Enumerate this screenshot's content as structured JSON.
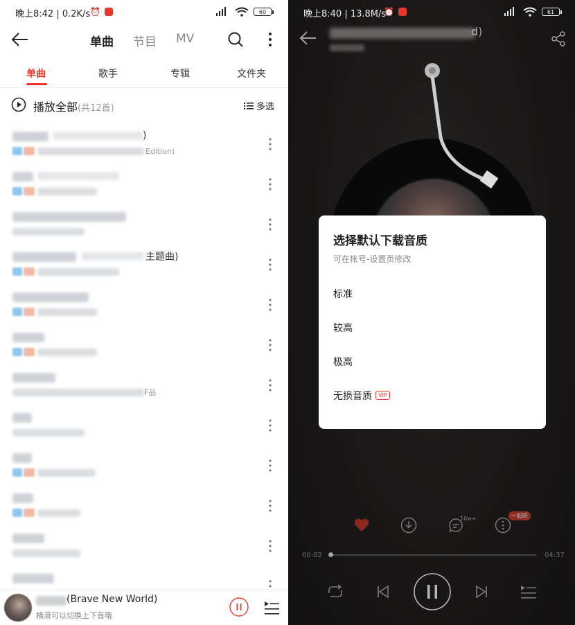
{
  "left": {
    "status_bar": {
      "text": "晚上8:42 | 0.2K/s",
      "battery": "60"
    },
    "top_nav": {
      "tabs": [
        "单曲",
        "节目",
        "MV"
      ],
      "active": "单曲"
    },
    "sub_tabs": [
      "单曲",
      "歌手",
      "专辑",
      "文件夹"
    ],
    "play_all": {
      "label": "播放全部",
      "count": "(共12首)",
      "multi_select": "多选"
    },
    "songs": [
      {
        "title_fragment": ")",
        "sub_fragment": "Edition)"
      },
      {
        "title_fragment": "",
        "sub_fragment": ""
      },
      {
        "title_fragment": "",
        "sub_fragment": ""
      },
      {
        "title_fragment": "主题曲)",
        "sub_fragment": ""
      },
      {
        "title_fragment": "",
        "sub_fragment": ""
      },
      {
        "title_fragment": "",
        "sub_fragment": ""
      },
      {
        "title_fragment": "",
        "sub_fragment": "F品"
      },
      {
        "title_fragment": "",
        "sub_fragment": ""
      },
      {
        "title_fragment": "",
        "sub_fragment": ""
      },
      {
        "title_fragment": "",
        "sub_fragment": ""
      },
      {
        "title_fragment": "",
        "sub_fragment": ""
      },
      {
        "title_fragment": "",
        "sub_fragment": ""
      }
    ],
    "mini_player": {
      "title": "(Brave New World)",
      "hint": "横滑可以切换上下首哦"
    }
  },
  "right": {
    "status_bar": {
      "text": "晚上8:40 | 13.8M/s",
      "battery": "61"
    },
    "title_fragment": "d)",
    "comment_count": "10w+",
    "together_badge": "一起听",
    "time_current": "00:02",
    "time_total": "04:37",
    "dialog": {
      "title": "选择默认下载音质",
      "subtitle": "可在帐号-设置页修改",
      "options": [
        "标准",
        "较高",
        "极高",
        "无损音质"
      ],
      "vip_label": "VIP"
    }
  }
}
